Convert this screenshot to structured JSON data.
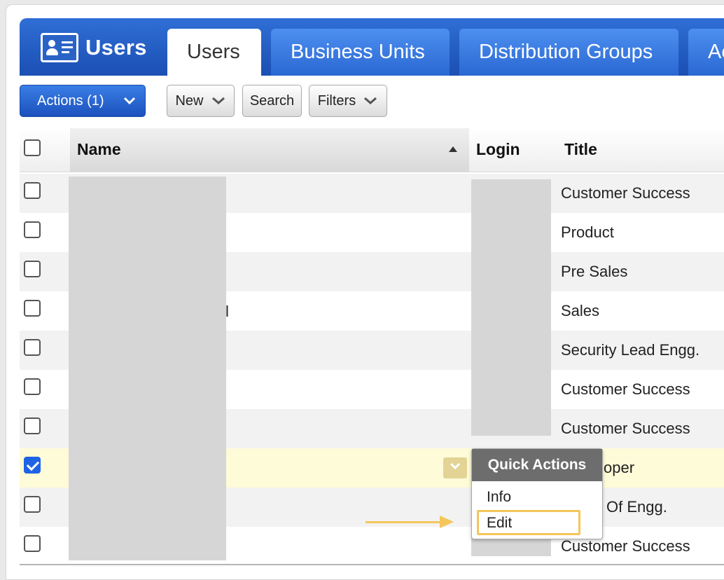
{
  "app": {
    "title": "Users"
  },
  "tabs": [
    {
      "label": "Users",
      "active": true
    },
    {
      "label": "Business Units",
      "active": false
    },
    {
      "label": "Distribution Groups",
      "active": false
    },
    {
      "label": "Ac",
      "active": false
    }
  ],
  "toolbar": {
    "actions_label": "Actions (1)",
    "new_label": "New",
    "search_label": "Search",
    "filters_label": "Filters"
  },
  "columns": {
    "name": "Name",
    "login": "Login",
    "title": "Title"
  },
  "rows": [
    {
      "title": "Customer Success",
      "checked": false
    },
    {
      "title": "Product",
      "checked": false
    },
    {
      "title": "Pre Sales",
      "checked": false
    },
    {
      "title": "Sales",
      "checked": false
    },
    {
      "title": "Security Lead Engg.",
      "checked": false
    },
    {
      "title": "Customer Success",
      "checked": false
    },
    {
      "title": "Customer Success",
      "checked": false
    },
    {
      "title": "oper",
      "checked": true
    },
    {
      "title": "Of Engg.",
      "checked": false
    },
    {
      "title": "Customer Success",
      "checked": false
    }
  ],
  "stray_text": "l",
  "quick_actions": {
    "title": "Quick Actions",
    "items": [
      "Info",
      "Edit"
    ]
  },
  "colors": {
    "header_blue": "#1b4fb3",
    "tab_blue": "#2a68d2",
    "selected_row": "#fefbd8",
    "highlight": "#f4c65a",
    "checkbox_checked": "#1e63e6"
  }
}
